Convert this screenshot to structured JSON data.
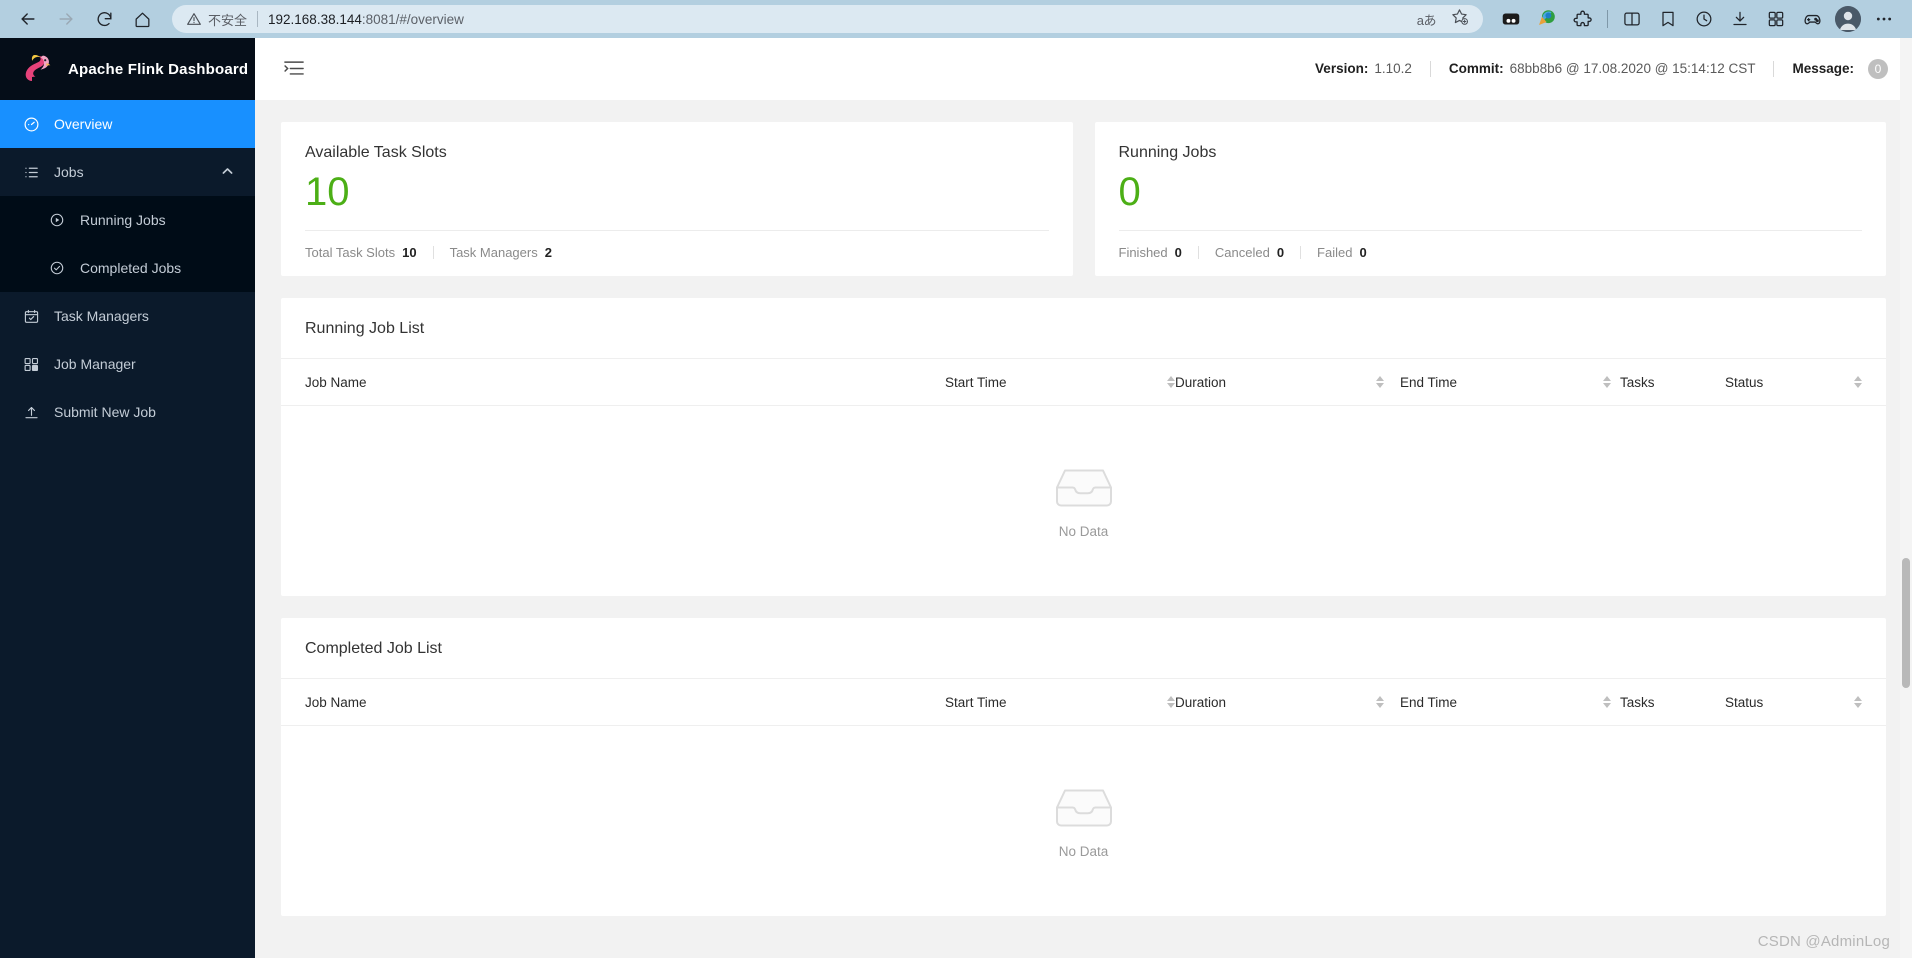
{
  "browser": {
    "nav": {
      "back": "back-arrow",
      "forward": "forward-arrow",
      "reload": "reload",
      "home": "home"
    },
    "security_label": "不安全",
    "url_host": "192.168.38.144",
    "url_rest": ":8081/#/overview",
    "reading_mode_label": "aあ",
    "icons": [
      "translate-icon",
      "favorite-star-icon",
      "collections-icon",
      "idm-download-icon",
      "extensions-icon",
      "split-screen-icon",
      "favorites-icon",
      "history-icon",
      "downloads-icon",
      "apps-icon",
      "games-icon",
      "profile-avatar",
      "settings-more-icon"
    ]
  },
  "sidebar": {
    "brand": "Apache Flink Dashboard",
    "items": [
      {
        "label": "Overview",
        "icon": "dashboard-icon",
        "active": true
      },
      {
        "label": "Jobs",
        "icon": "list-icon",
        "active": false,
        "expanded": true
      },
      {
        "label": "Running Jobs",
        "icon": "play-circle-icon",
        "sub": true
      },
      {
        "label": "Completed Jobs",
        "icon": "check-circle-icon",
        "sub": true
      },
      {
        "label": "Task Managers",
        "icon": "calendar-check-icon"
      },
      {
        "label": "Job Manager",
        "icon": "cluster-icon"
      },
      {
        "label": "Submit New Job",
        "icon": "upload-icon"
      }
    ]
  },
  "topbar": {
    "version_key": "Version:",
    "version_value": "1.10.2",
    "commit_key": "Commit:",
    "commit_value": "68bb8b6 @ 17.08.2020 @ 15:14:12 CST",
    "message_key": "Message:",
    "message_count": "0"
  },
  "cards": {
    "task_slots": {
      "title": "Available Task Slots",
      "value": "10",
      "footer": [
        {
          "label": "Total Task Slots",
          "value": "10"
        },
        {
          "label": "Task Managers",
          "value": "2"
        }
      ]
    },
    "running_jobs": {
      "title": "Running Jobs",
      "value": "0",
      "footer": [
        {
          "label": "Finished",
          "value": "0"
        },
        {
          "label": "Canceled",
          "value": "0"
        },
        {
          "label": "Failed",
          "value": "0"
        }
      ]
    }
  },
  "running_list": {
    "title": "Running Job List",
    "columns": [
      "Job Name",
      "Start Time",
      "Duration",
      "End Time",
      "Tasks",
      "Status"
    ],
    "rows": [],
    "empty_text": "No Data"
  },
  "completed_list": {
    "title": "Completed Job List",
    "columns": [
      "Job Name",
      "Start Time",
      "Duration",
      "End Time",
      "Tasks",
      "Status"
    ],
    "rows": [],
    "empty_text": "No Data"
  },
  "watermark": "CSDN @AdminLog",
  "colors": {
    "sidebar_bg": "#0b1a2b",
    "sidebar_active": "#1890ff",
    "submenu_bg": "#000c17",
    "stat_green": "#4caf16",
    "browser_bar": "#b3cfe0"
  }
}
